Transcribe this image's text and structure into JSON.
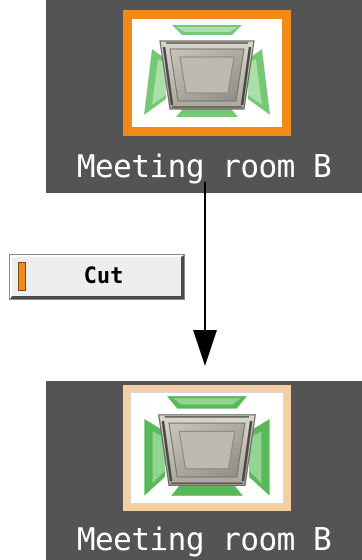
{
  "before": {
    "room_name": "Meeting room B",
    "icon": "cassette-ac-unit-icon",
    "state": "selected"
  },
  "action": {
    "cut_label": "Cut",
    "indicator_color": "#f28a1a"
  },
  "after": {
    "room_name": "Meeting room B",
    "icon": "cassette-ac-unit-icon",
    "state": "cut"
  },
  "colors": {
    "panel": "#545454",
    "selected_border": "#f28a1a",
    "cut_border": "#f5cfa4",
    "airflow_green": "#76c776"
  }
}
